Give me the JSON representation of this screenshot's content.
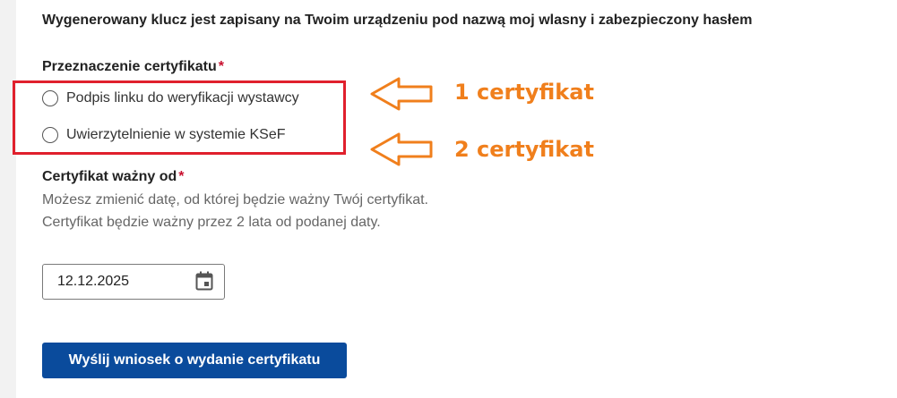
{
  "form": {
    "info_text": "Wygenerowany klucz jest zapisany na Twoim urządzeniu pod nazwą moj wlasny i zabezpieczony hasłem",
    "purpose": {
      "label": "Przeznaczenie certyfikatu",
      "required_mark": "*",
      "options": [
        {
          "label": "Podpis linku do weryfikacji wystawcy",
          "selected": false
        },
        {
          "label": "Uwierzytelnienie w systemie KSeF",
          "selected": false
        }
      ]
    },
    "valid_from": {
      "label": "Certyfikat ważny od",
      "required_mark": "*",
      "help": "Możesz zmienić datę, od której będzie ważny Twój certyfikat. Certyfikat będzie ważny przez 2 lata od podanej daty.",
      "value": "12.12.2025",
      "icon": "calendar-icon"
    },
    "submit_label": "Wyślij wniosek o wydanie certyfikatu"
  },
  "annotations": {
    "color": "#f07f1c",
    "highlight_color": "#e0202d",
    "items": [
      {
        "label": "1 certyfikat"
      },
      {
        "label": "2 certyfikat"
      }
    ]
  },
  "colors": {
    "primary": "#0a4b9c",
    "required": "#c8102e",
    "help_text": "#666666"
  }
}
